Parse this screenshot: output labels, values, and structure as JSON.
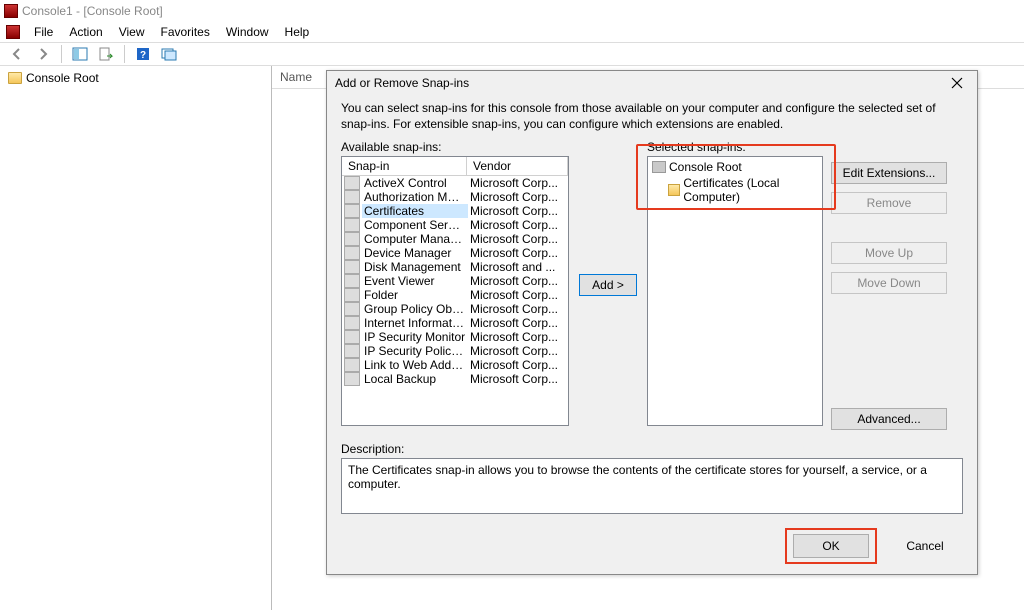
{
  "window": {
    "title": "Console1 - [Console Root]"
  },
  "menu": {
    "file": "File",
    "action": "Action",
    "view": "View",
    "favorites": "Favorites",
    "window": "Window",
    "help": "Help"
  },
  "tree": {
    "root": "Console Root"
  },
  "content": {
    "name_col": "Name"
  },
  "dialog": {
    "title": "Add or Remove Snap-ins",
    "intro": "You can select snap-ins for this console from those available on your computer and configure the selected set of snap-ins. For extensible snap-ins, you can configure which extensions are enabled.",
    "available_label": "Available snap-ins:",
    "selected_label": "Selected snap-ins:",
    "col_snapin": "Snap-in",
    "col_vendor": "Vendor",
    "add_btn": "Add >",
    "edit_ext_btn": "Edit Extensions...",
    "remove_btn": "Remove",
    "moveup_btn": "Move Up",
    "movedown_btn": "Move Down",
    "advanced_btn": "Advanced...",
    "description_label": "Description:",
    "description_text": "The Certificates snap-in allows you to browse the contents of the certificate stores for yourself, a service, or a computer.",
    "ok": "OK",
    "cancel": "Cancel",
    "selected": {
      "root": "Console Root",
      "child": "Certificates (Local Computer)"
    },
    "snapins": [
      {
        "name": "ActiveX Control",
        "vendor": "Microsoft Corp..."
      },
      {
        "name": "Authorization Manager",
        "vendor": "Microsoft Corp..."
      },
      {
        "name": "Certificates",
        "vendor": "Microsoft Corp...",
        "selected": true
      },
      {
        "name": "Component Services",
        "vendor": "Microsoft Corp..."
      },
      {
        "name": "Computer Managem...",
        "vendor": "Microsoft Corp..."
      },
      {
        "name": "Device Manager",
        "vendor": "Microsoft Corp..."
      },
      {
        "name": "Disk Management",
        "vendor": "Microsoft and ..."
      },
      {
        "name": "Event Viewer",
        "vendor": "Microsoft Corp..."
      },
      {
        "name": "Folder",
        "vendor": "Microsoft Corp..."
      },
      {
        "name": "Group Policy Object ...",
        "vendor": "Microsoft Corp..."
      },
      {
        "name": "Internet Information ...",
        "vendor": "Microsoft Corp..."
      },
      {
        "name": "IP Security Monitor",
        "vendor": "Microsoft Corp..."
      },
      {
        "name": "IP Security Policy Ma...",
        "vendor": "Microsoft Corp..."
      },
      {
        "name": "Link to Web Address",
        "vendor": "Microsoft Corp..."
      },
      {
        "name": "Local Backup",
        "vendor": "Microsoft Corp..."
      }
    ]
  }
}
